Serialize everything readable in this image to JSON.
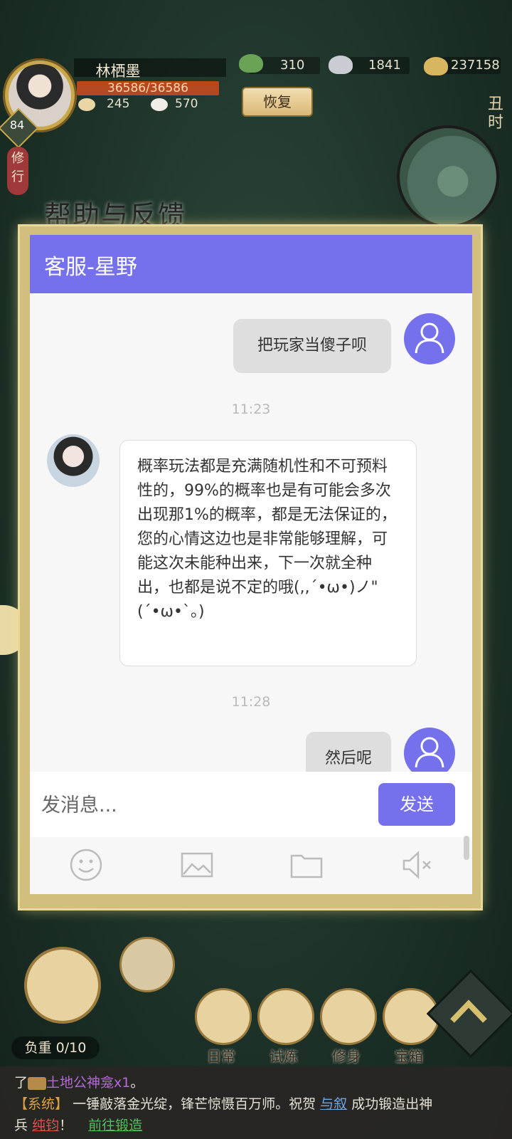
{
  "player": {
    "name": "林栖墨",
    "level": "84",
    "hp": "36586/36586",
    "stat1": "245",
    "stat2": "570",
    "practice_label": "修行"
  },
  "resources": [
    {
      "icon": "jade-icon",
      "value": "310"
    },
    {
      "icon": "silver-ingot-icon",
      "value": "1841"
    },
    {
      "icon": "coins-icon",
      "value": "237158"
    }
  ],
  "recover_label": "恢复",
  "time_of_day": "丑时",
  "help_title": "帮助与反馈",
  "dialog": {
    "title": "客服-星野",
    "messages": [
      {
        "side": "right",
        "text": "把玩家当傻子呗"
      },
      {
        "type": "time",
        "text": "11:23"
      },
      {
        "side": "left",
        "text": "概率玩法都是充满随机性和不可预料性的，99%的概率也是有可能会多次出现那1%的概率，都是无法保证的，您的心情这边也是非常能够理解，可能这次未能种出来，下一次就全种出，也都是说不定的哦(,,´•ω•)ノ\"(´•ω•`。)"
      },
      {
        "type": "time",
        "text": "11:28"
      },
      {
        "side": "right",
        "text": "然后呢"
      }
    ],
    "input_placeholder": "发消息...",
    "send_label": "发送",
    "tools": [
      "emoji-icon",
      "image-icon",
      "folder-icon",
      "mute-icon"
    ]
  },
  "bottom": {
    "load": "负重 0/10",
    "nav": [
      {
        "label": "日常"
      },
      {
        "label": "试炼"
      },
      {
        "label": "修身"
      },
      {
        "label": "宝箱"
      }
    ]
  },
  "log": {
    "line1_prefix": "了",
    "line1_item": "土地公神龛x1",
    "line1_suffix": "。",
    "line2_tag": "【系统】",
    "line2_text": "一锤敲落金光绽，锋芒惊慑百万师。祝贺",
    "line2_player": "与叙",
    "line2_text2": "成功锻造出神",
    "line3_text": "兵",
    "line3_item": "纯钧",
    "line3_text2": "！",
    "line3_link": "前往锻造"
  }
}
